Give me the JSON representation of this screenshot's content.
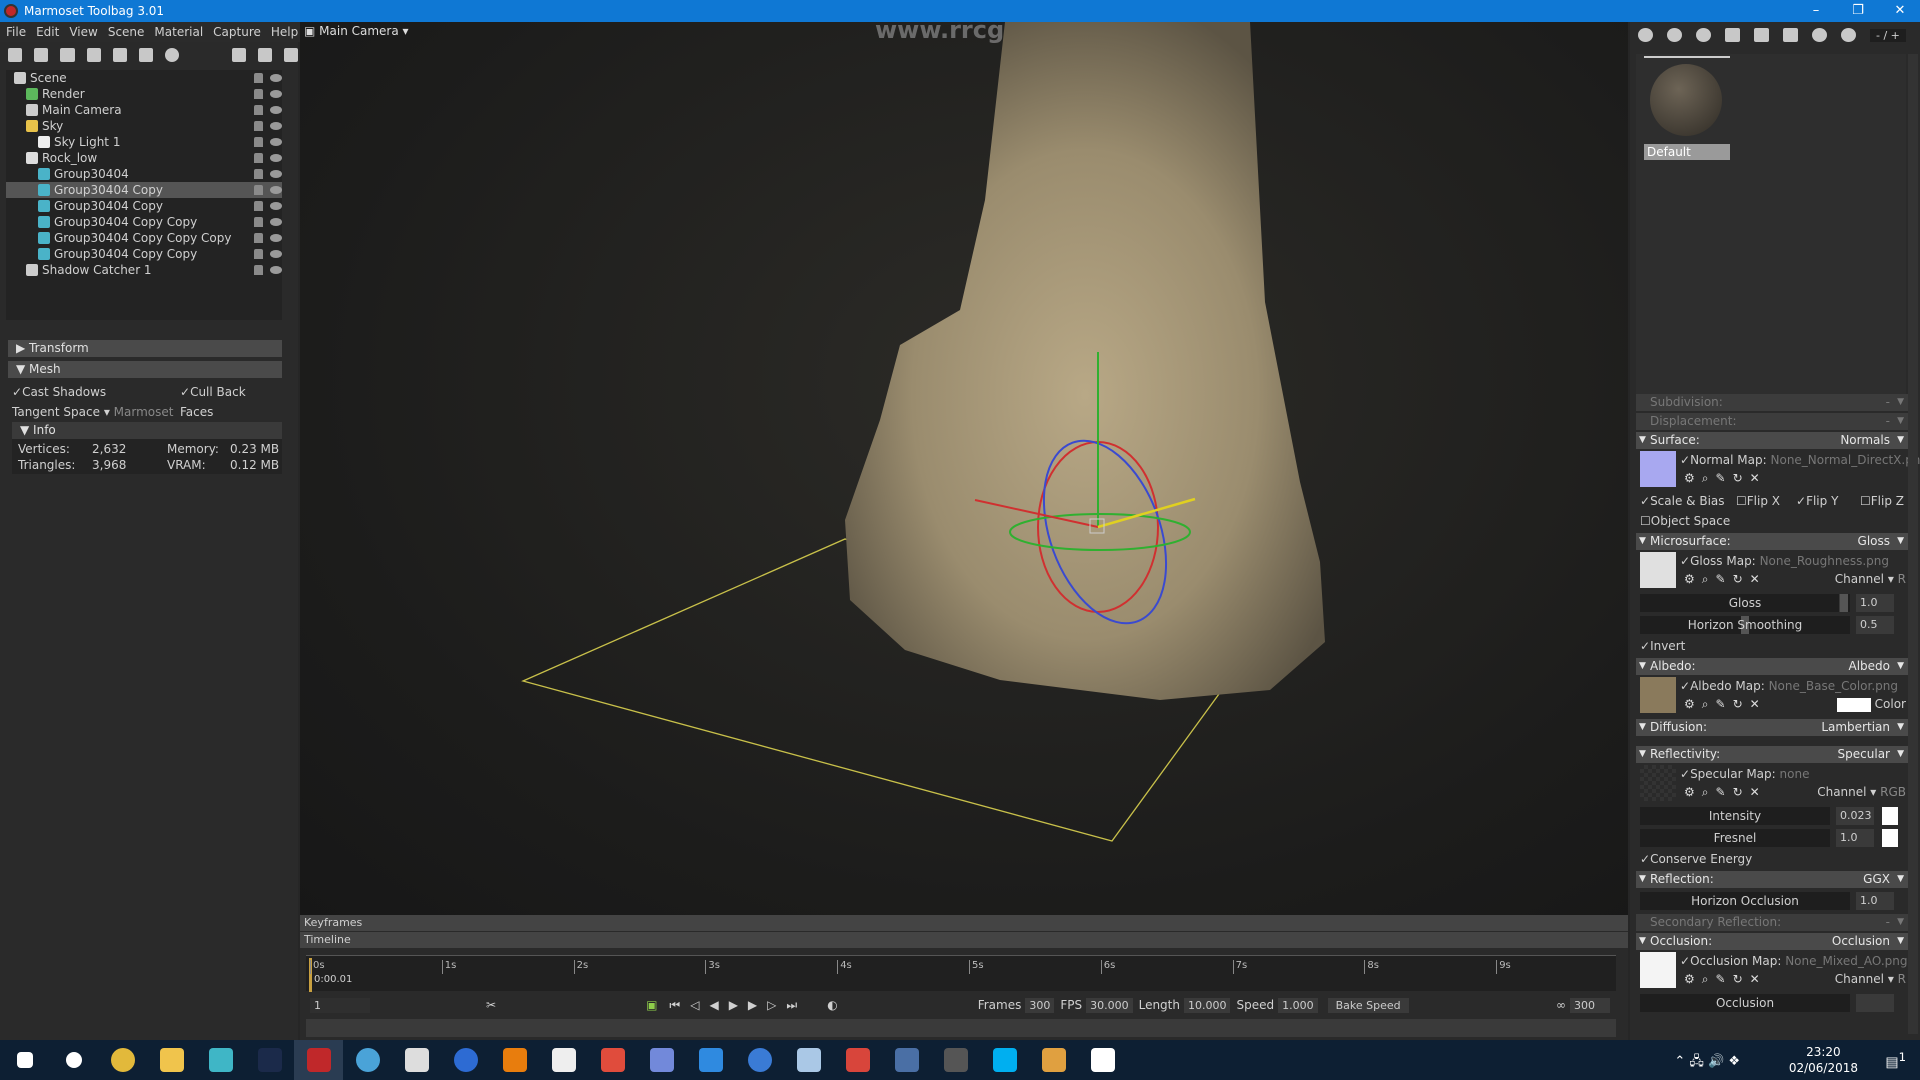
{
  "window": {
    "title": "Marmoset Toolbag 3.01",
    "minimize": "–",
    "maximize": "❐",
    "close": "✕",
    "accent": "#0f78d4"
  },
  "menu": [
    "File",
    "Edit",
    "View",
    "Scene",
    "Material",
    "Capture",
    "Help"
  ],
  "scene_tree": [
    {
      "label": "Scene",
      "indent": 0,
      "icon": "scene-icon",
      "color": "#cccccc"
    },
    {
      "label": "Render",
      "indent": 1,
      "icon": "render-gear-icon",
      "color": "#5cb85c"
    },
    {
      "label": "Main Camera",
      "indent": 1,
      "icon": "camera-icon",
      "color": "#cccccc"
    },
    {
      "label": "Sky",
      "indent": 1,
      "icon": "sky-icon",
      "color": "#e8c24a"
    },
    {
      "label": "Sky Light 1",
      "indent": 2,
      "icon": "light-bulb-icon",
      "color": "#eeeeee"
    },
    {
      "label": "Rock_low",
      "indent": 1,
      "icon": "mesh-group-icon",
      "color": "#dddddd"
    },
    {
      "label": "Group30404",
      "indent": 2,
      "icon": "mesh-cube-icon",
      "color": "#4ab3c8"
    },
    {
      "label": "Group30404 Copy",
      "indent": 2,
      "icon": "mesh-cube-icon",
      "color": "#4ab3c8",
      "selected": true
    },
    {
      "label": "Group30404 Copy",
      "indent": 2,
      "icon": "mesh-cube-icon",
      "color": "#4ab3c8"
    },
    {
      "label": "Group30404 Copy Copy",
      "indent": 2,
      "icon": "mesh-cube-icon",
      "color": "#4ab3c8"
    },
    {
      "label": "Group30404 Copy Copy Copy",
      "indent": 2,
      "icon": "mesh-cube-icon",
      "color": "#4ab3c8"
    },
    {
      "label": "Group30404 Copy Copy",
      "indent": 2,
      "icon": "mesh-cube-icon",
      "color": "#4ab3c8"
    },
    {
      "label": "Shadow Catcher 1",
      "indent": 1,
      "icon": "shadow-catcher-icon",
      "color": "#cccccc"
    }
  ],
  "properties": {
    "transform": "Transform",
    "mesh": "Mesh",
    "cast_shadows": "Cast Shadows",
    "cull_back_faces": "Cull Back Faces",
    "tangent_space_label": "Tangent Space",
    "tangent_space_value": "Marmoset",
    "info": "Info",
    "vertices_label": "Vertices:",
    "vertices": "2,632",
    "triangles_label": "Triangles:",
    "triangles": "3,968",
    "memory_label": "Memory:",
    "memory": "0.23 MB",
    "vram_label": "VRAM:",
    "vram": "0.12 MB"
  },
  "viewport": {
    "camera": "Main Camera",
    "watermark": "www.rrcg.cn"
  },
  "timeline": {
    "keyframes": "Keyframes",
    "timeline": "Timeline",
    "ticks": [
      "0s",
      "1s",
      "2s",
      "3s",
      "4s",
      "5s",
      "6s",
      "7s",
      "8s",
      "9s"
    ],
    "current_time": "0:00.01",
    "current_frame": "1",
    "frames_label": "Frames",
    "frames": "300",
    "fps_label": "FPS",
    "fps": "30.000",
    "length_label": "Length",
    "length": "10.000",
    "speed_label": "Speed",
    "speed": "1.000",
    "bake_speed": "Bake Speed",
    "end_frame": "300"
  },
  "material": {
    "pager": "- / +",
    "name": "Default",
    "subdivision": "Subdivision:",
    "displacement": "Displacement:",
    "dash": "-",
    "surface": "Surface:",
    "surface_val": "Normals",
    "normal_map_label": "Normal Map:",
    "normal_map": "None_Normal_DirectX.png",
    "scale_bias": "Scale & Bias",
    "flip_x": "Flip X",
    "flip_y": "Flip Y",
    "flip_z": "Flip Z",
    "object_space": "Object Space",
    "microsurface": "Microsurface:",
    "microsurface_val": "Gloss",
    "gloss_map_label": "Gloss Map:",
    "gloss_map": "None_Roughness.png",
    "channel": "Channel",
    "channel_r": "R",
    "channel_rgb": "RGB",
    "gloss": "Gloss",
    "gloss_val": "1.0",
    "gloss_fraction": 0.97,
    "horizon_smoothing": "Horizon Smoothing",
    "horizon_smoothing_val": "0.5",
    "horizon_smoothing_fraction": 0.5,
    "invert": "Invert",
    "albedo": "Albedo:",
    "albedo_val": "Albedo",
    "albedo_map_label": "Albedo Map:",
    "albedo_map": "None_Base_Color.png",
    "color": "Color",
    "diffusion": "Diffusion:",
    "diffusion_val": "Lambertian",
    "reflectivity": "Reflectivity:",
    "reflectivity_val": "Specular",
    "specular_map_label": "Specular Map:",
    "specular_map": "none",
    "intensity": "Intensity",
    "intensity_val": "0.023",
    "fresnel": "Fresnel",
    "fresnel_val": "1.0",
    "conserve_energy": "Conserve Energy",
    "reflection": "Reflection:",
    "reflection_val": "GGX",
    "horizon_occlusion": "Horizon Occlusion",
    "horizon_occlusion_val": "1.0",
    "secondary_reflection": "Secondary Reflection:",
    "occlusion": "Occlusion:",
    "occlusion_val": "Occlusion",
    "occlusion_map_label": "Occlusion Map:",
    "occlusion_map": "None_Mixed_AO.png",
    "occlusion_slider": "Occlusion"
  },
  "taskbar": {
    "apps": [
      {
        "icon": "start-icon",
        "color": "#ffffff"
      },
      {
        "icon": "cortana-icon",
        "color": "#ffffff"
      },
      {
        "icon": "chrome-icon",
        "color": "#e2b93b"
      },
      {
        "icon": "file-explorer-icon",
        "color": "#f0c44c"
      },
      {
        "icon": "maya-icon",
        "color": "#3fb6c6"
      },
      {
        "icon": "photoshop-icon",
        "color": "#1b2a4a"
      },
      {
        "icon": "marmoset-icon",
        "color": "#c0282a"
      },
      {
        "icon": "steam-like-icon",
        "color": "#4aa3d8"
      },
      {
        "icon": "substance-icon",
        "color": "#dddddd"
      },
      {
        "icon": "speedtree-icon",
        "color": "#2d6bd3"
      },
      {
        "icon": "blender-icon",
        "color": "#e87d0d"
      },
      {
        "icon": "unity-icon",
        "color": "#eeeeee"
      },
      {
        "icon": "substance-painter-icon",
        "color": "#e04c3c"
      },
      {
        "icon": "discord-icon",
        "color": "#7289da"
      },
      {
        "icon": "app-blue-icon",
        "color": "#2f8ae0"
      },
      {
        "icon": "app-circle-icon",
        "color": "#3a7bd5"
      },
      {
        "icon": "steam-icon",
        "color": "#aac8e6"
      },
      {
        "icon": "substance-designer-icon",
        "color": "#d8453b"
      },
      {
        "icon": "calculator-icon",
        "color": "#4a6fa5"
      },
      {
        "icon": "obs-icon",
        "color": "#555555"
      },
      {
        "icon": "skype-icon",
        "color": "#00aff0"
      },
      {
        "icon": "app-orange-icon",
        "color": "#e0a040"
      },
      {
        "icon": "photos-icon",
        "color": "#ffffff"
      }
    ],
    "time": "23:20",
    "date": "02/06/2018",
    "notifications": "1"
  }
}
